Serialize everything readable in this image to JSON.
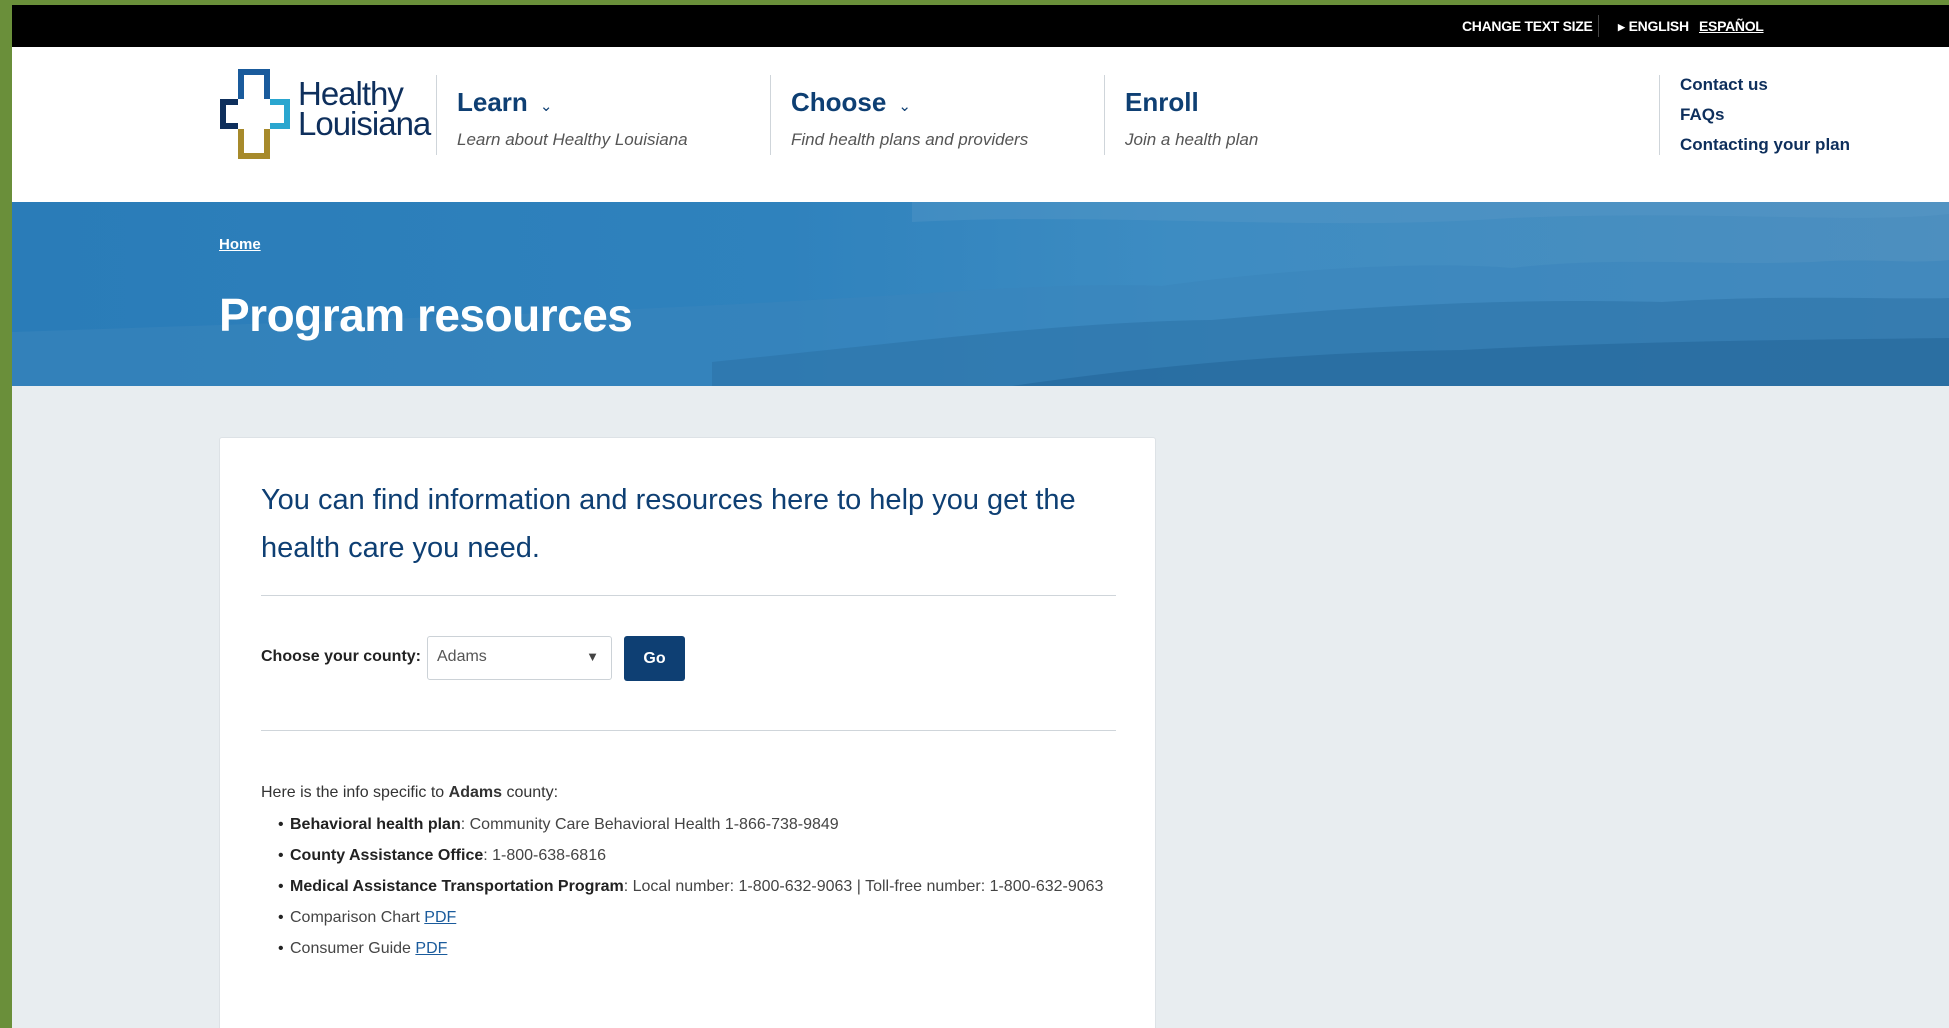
{
  "utility_bar": {
    "change_text_size": "CHANGE TEXT SIZE",
    "lang_english": "ENGLISH",
    "lang_espanol": "ESPAÑOL"
  },
  "logo": {
    "line1": "Healthy",
    "line2": "Louisiana"
  },
  "nav": [
    {
      "title": "Learn",
      "subtitle": "Learn about Healthy Louisiana"
    },
    {
      "title": "Choose",
      "subtitle": "Find health plans and providers"
    },
    {
      "title": "Enroll",
      "subtitle": "Join a health plan"
    }
  ],
  "utility_links": [
    "Contact us",
    "FAQs",
    "Contacting your plan"
  ],
  "breadcrumb": {
    "home": "Home"
  },
  "page_title": "Program resources",
  "card": {
    "intro": "You can find information and resources here to help you get the health care you need.",
    "county_label": "Choose your county:",
    "county_selected": "Adams",
    "go_label": "Go",
    "info_prefix": "Here is the info specific to ",
    "info_county": "Adams",
    "info_suffix": " county:",
    "items": [
      {
        "label": "Behavioral health plan",
        "text": ": Community Care Behavioral Health 1-866-738-9849"
      },
      {
        "label": "County Assistance Office",
        "text": ": 1-800-638-6816"
      },
      {
        "label": "Medical Assistance Transportation Program",
        "text": ": Local number: 1-800-632-9063 | Toll-free number: 1-800-632-9063"
      }
    ],
    "links": [
      {
        "text": "Comparison Chart ",
        "link": "PDF"
      },
      {
        "text": "Consumer Guide ",
        "link": "PDF"
      }
    ]
  },
  "colors": {
    "navy": "#0e3f73",
    "hero_blue": "#2f82bd",
    "page_bg": "#e8edf0",
    "logo_blue": "#1a5b9c",
    "logo_cyan": "#2aa6cf",
    "logo_gold": "#a78a2b"
  }
}
